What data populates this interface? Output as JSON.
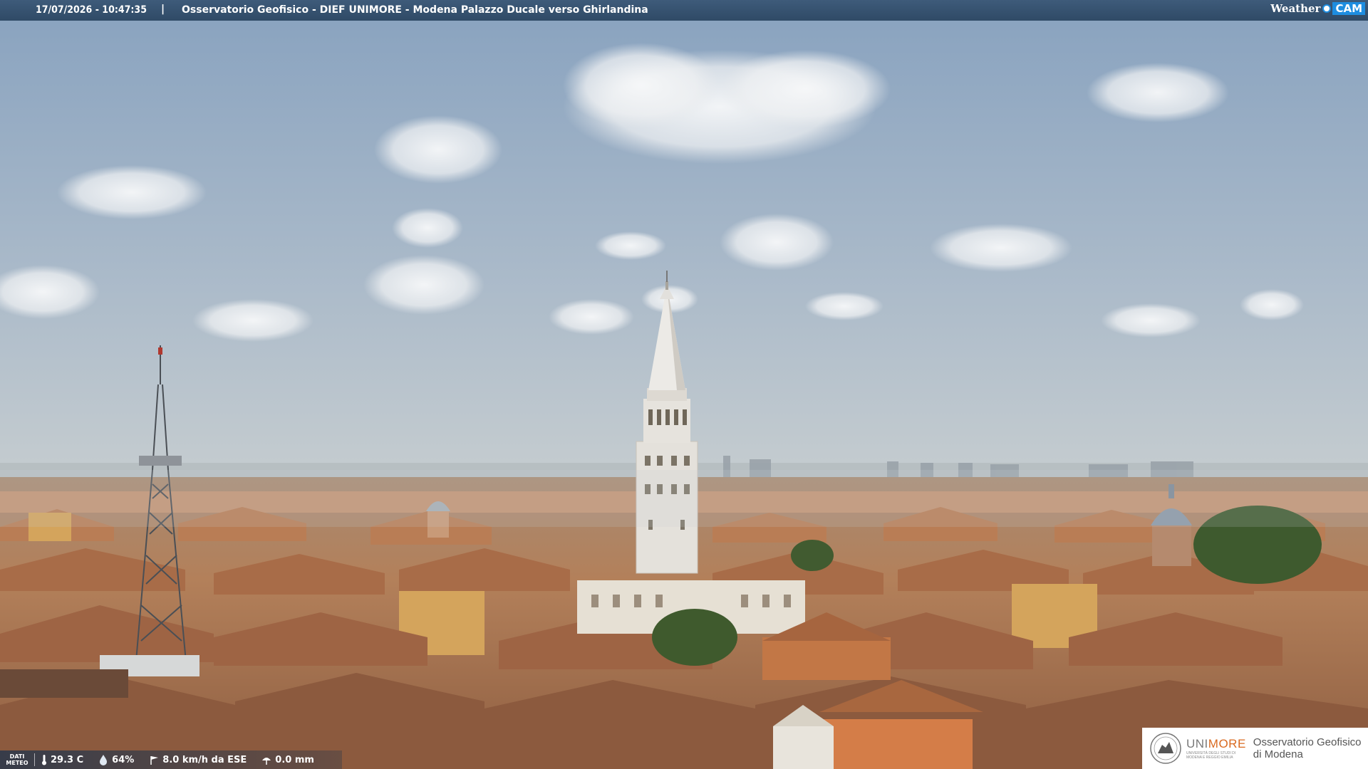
{
  "overlay": {
    "timestamp": "17/07/2026 - 10:47:35",
    "separator": "|",
    "camera_title": "Osservatorio Geofisico - DIEF UNIMORE - Modena Palazzo Ducale verso Ghirlandina"
  },
  "brand": {
    "weather_text": "Weather",
    "cam_text": "CAM"
  },
  "meteo": {
    "label_line1": "DATI",
    "label_line2": "METEO",
    "temperature": "29.3 C",
    "humidity": "64%",
    "wind": "8.0 km/h da ESE",
    "rain": "0.0 mm"
  },
  "logo": {
    "university_prefix": "UNI",
    "university_suffix": "MORE",
    "university_sub_1": "UNIVERSITÀ DEGLI STUDI DI",
    "university_sub_2": "MODENA E REGGIO EMILIA",
    "observatory_line1": "Osservatorio Geofisico",
    "observatory_line2": "di Modena"
  },
  "colors": {
    "sky_top": "#8ea7c1",
    "sky_horizon": "#c3ccd0",
    "roof": "#b9845e",
    "tower": "#e8e6e0",
    "bar": "#34506e",
    "accent": "#1e8de0",
    "unimore_orange": "#d96a20"
  },
  "icons": {
    "temperature": "thermometer-icon",
    "humidity": "droplet-icon",
    "wind": "wind-icon",
    "rain": "rain-gauge-icon"
  }
}
